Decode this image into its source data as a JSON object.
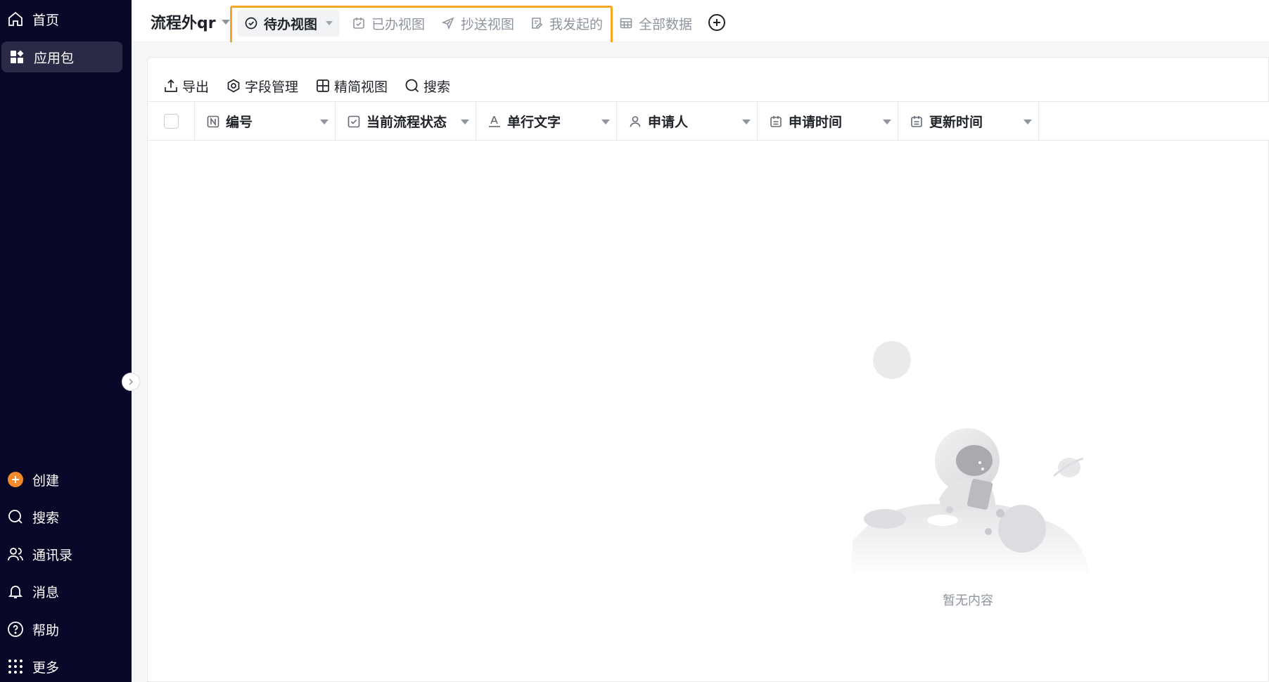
{
  "sidebar": {
    "top_items": [
      {
        "label": "首页",
        "icon": "home-icon"
      },
      {
        "label": "应用包",
        "icon": "apps-icon",
        "active": true
      }
    ],
    "bottom_items": [
      {
        "label": "创建",
        "icon": "plus-circle-icon"
      },
      {
        "label": "搜索",
        "icon": "search-icon"
      },
      {
        "label": "通讯录",
        "icon": "contacts-icon"
      },
      {
        "label": "消息",
        "icon": "bell-icon"
      },
      {
        "label": "帮助",
        "icon": "help-icon"
      },
      {
        "label": "更多",
        "icon": "grid-icon"
      }
    ]
  },
  "header": {
    "app_title": "流程外qr",
    "tabs": [
      {
        "label": "待办视图",
        "icon": "check-circle-icon",
        "active": true
      },
      {
        "label": "已办视图",
        "icon": "calendar-check-icon"
      },
      {
        "label": "抄送视图",
        "icon": "send-icon"
      },
      {
        "label": "我发起的",
        "icon": "edit-doc-icon"
      },
      {
        "label": "全部数据",
        "icon": "table-icon"
      }
    ]
  },
  "toolbar": {
    "items": [
      {
        "label": "导出",
        "icon": "export-icon"
      },
      {
        "label": "字段管理",
        "icon": "settings-icon"
      },
      {
        "label": "精简视图",
        "icon": "grid-view-icon"
      },
      {
        "label": "搜索",
        "icon": "search-icon"
      }
    ]
  },
  "table": {
    "columns": [
      {
        "label": "编号",
        "icon": "number-field-icon"
      },
      {
        "label": "当前流程状态",
        "icon": "checkbox-field-icon"
      },
      {
        "label": "单行文字",
        "icon": "text-field-icon"
      },
      {
        "label": "申请人",
        "icon": "person-field-icon"
      },
      {
        "label": "申请时间",
        "icon": "date-field-icon"
      },
      {
        "label": "更新时间",
        "icon": "date-field-icon"
      }
    ]
  },
  "empty_state": {
    "text": "暂无内容"
  },
  "colors": {
    "sidebar_bg": "#080727",
    "highlight_border": "#f5a623",
    "create_accent": "#f5892b"
  }
}
